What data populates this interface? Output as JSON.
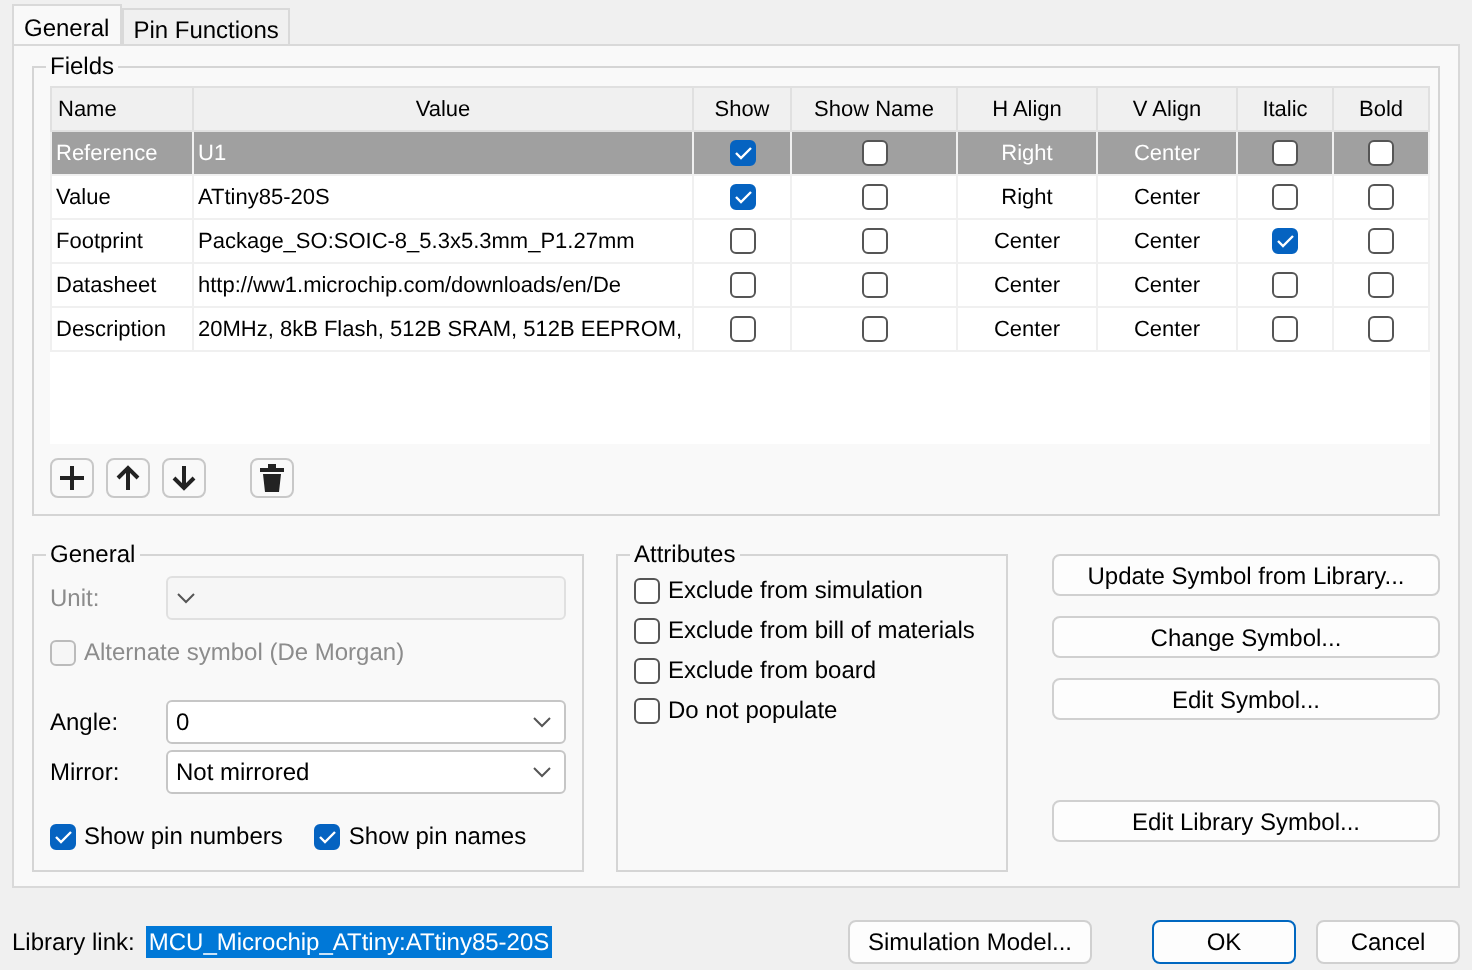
{
  "tabs": [
    {
      "label": "General",
      "selected": true
    },
    {
      "label": "Pin Functions",
      "selected": false
    }
  ],
  "fields": {
    "title": "Fields",
    "columns": [
      "Name",
      "Value",
      "Show",
      "Show Name",
      "H Align",
      "V Align",
      "Italic",
      "Bold"
    ],
    "rows": [
      {
        "name": "Reference",
        "value": "U1",
        "show": true,
        "show_name": false,
        "h_align": "Right",
        "v_align": "Center",
        "italic": false,
        "bold": false,
        "selected": true
      },
      {
        "name": "Value",
        "value": "ATtiny85-20S",
        "show": true,
        "show_name": false,
        "h_align": "Right",
        "v_align": "Center",
        "italic": false,
        "bold": false,
        "selected": false
      },
      {
        "name": "Footprint",
        "value": "Package_SO:SOIC-8_5.3x5.3mm_P1.27mm",
        "show": false,
        "show_name": false,
        "h_align": "Center",
        "v_align": "Center",
        "italic": true,
        "bold": false,
        "selected": false
      },
      {
        "name": "Datasheet",
        "value": "http://ww1.microchip.com/downloads/en/De",
        "show": false,
        "show_name": false,
        "h_align": "Center",
        "v_align": "Center",
        "italic": false,
        "bold": false,
        "selected": false
      },
      {
        "name": "Description",
        "value": "20MHz, 8kB Flash, 512B SRAM, 512B EEPROM,",
        "show": false,
        "show_name": false,
        "h_align": "Center",
        "v_align": "Center",
        "italic": false,
        "bold": false,
        "selected": false
      }
    ],
    "toolbar": [
      {
        "kind": "add"
      },
      {
        "kind": "up"
      },
      {
        "kind": "down"
      },
      {
        "kind": "delete"
      }
    ]
  },
  "general": {
    "title": "General",
    "unit": {
      "label": "Unit:",
      "disabled": true
    },
    "alternate": {
      "label": "Alternate symbol (De Morgan)",
      "checked": false,
      "disabled": true
    },
    "angle": {
      "label": "Angle:",
      "value": "0"
    },
    "mirror": {
      "label": "Mirror:",
      "value": "Not mirrored"
    },
    "options": [
      {
        "label": "Show pin numbers",
        "checked": true
      },
      {
        "label": "Show pin names",
        "checked": true
      }
    ]
  },
  "attributes": {
    "title": "Attributes",
    "items": [
      {
        "label": "Exclude from simulation",
        "checked": false
      },
      {
        "label": "Exclude from bill of materials",
        "checked": false
      },
      {
        "label": "Exclude from board",
        "checked": false
      },
      {
        "label": "Do not populate",
        "checked": false
      }
    ]
  },
  "actions": [
    "Update Symbol from Library...",
    "Change Symbol...",
    "Edit Symbol...",
    "Edit Library Symbol..."
  ],
  "library_link": {
    "label": "Library link:",
    "value": "MCU_Microchip_ATtiny:ATtiny85-20S",
    "selected": true
  },
  "buttons": [
    {
      "label": "Simulation Model...",
      "default": false
    },
    {
      "label": "OK",
      "default": true
    },
    {
      "label": "Cancel",
      "default": false
    }
  ]
}
